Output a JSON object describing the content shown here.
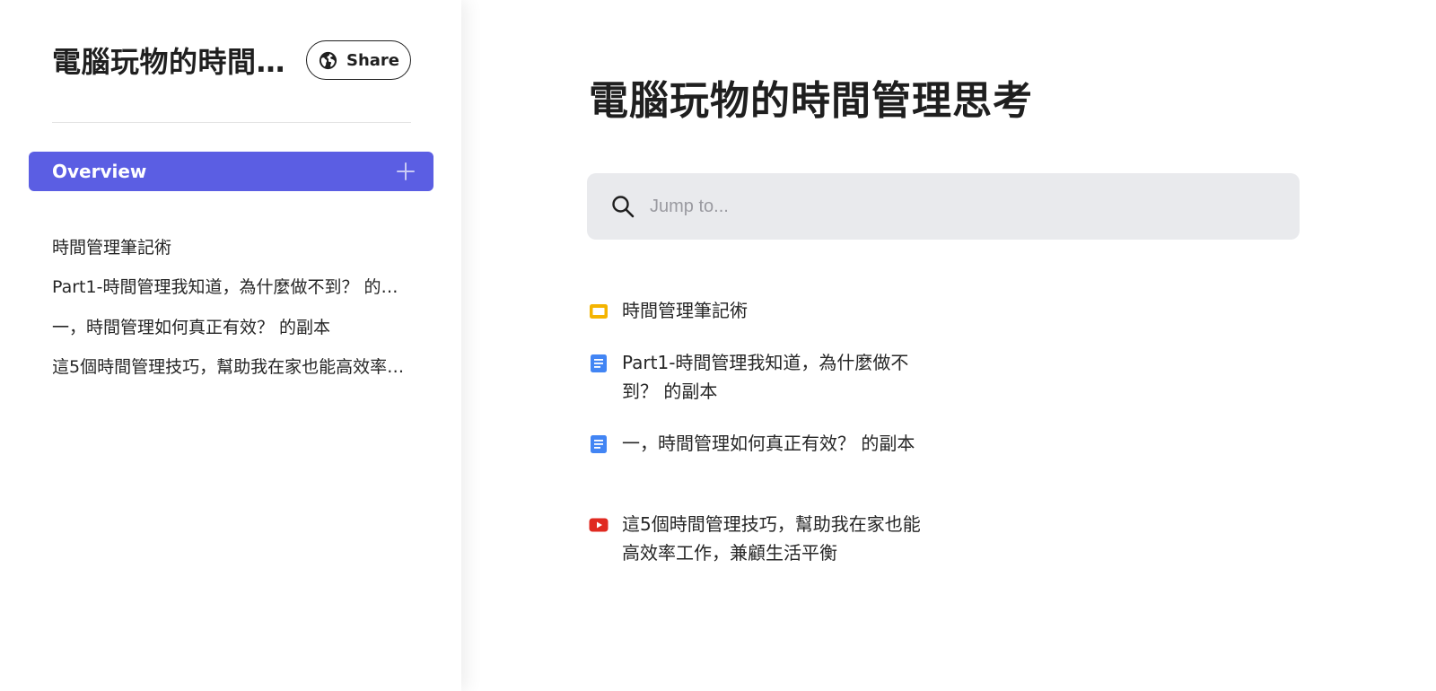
{
  "sidebar": {
    "notebook_title": "電腦玩物的時間管理思考",
    "share_label": "Share",
    "overview_label": "Overview",
    "items": [
      {
        "label": "時間管理筆記術"
      },
      {
        "label": "Part1-時間管理我知道，為什麼做不到？ 的副本"
      },
      {
        "label": "一，時間管理如何真正有效？ 的副本"
      },
      {
        "label": "這5個時間管理技巧，幫助我在家也能高效率工作，兼顧生活平衡"
      }
    ]
  },
  "main": {
    "title": "電腦玩物的時間管理思考",
    "search": {
      "placeholder": "Jump to...",
      "value": ""
    },
    "documents": [
      {
        "title": "時間管理筆記術",
        "icon": "slides-icon"
      },
      {
        "title": "Part1-時間管理我知道，為什麼做不到？ 的副本",
        "icon": "doc-icon"
      },
      {
        "title": "一，時間管理如何真正有效？ 的副本",
        "icon": "doc-icon"
      },
      {
        "title": "這5個時間管理技巧，幫助我在家也能高效率工作，兼顧生活平衡",
        "icon": "youtube-icon"
      }
    ]
  },
  "colors": {
    "accent": "#5b5ee3",
    "search_bg": "#e9eaed",
    "slides_icon": "#f4b400",
    "doc_icon": "#4285f4",
    "youtube_icon": "#e02a20"
  }
}
